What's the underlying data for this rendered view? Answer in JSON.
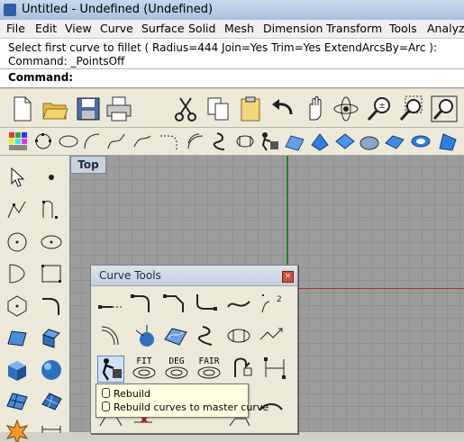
{
  "window": {
    "title": "Untitled - Undefined (Undefined)"
  },
  "menu": [
    "File",
    "Edit",
    "View",
    "Curve",
    "Surface",
    "Solid",
    "Mesh",
    "Dimension",
    "Transform",
    "Tools",
    "Analyze"
  ],
  "command": {
    "history_line": "Select first curve to fillet ( Radius=444  Join=Yes  Trim=Yes  ExtendArcsBy=Arc ):",
    "history_line2": "Command: _PointsOff",
    "prompt_label": "Command:"
  },
  "toolbar_main": [
    "new-icon",
    "open-icon",
    "save-icon",
    "print-icon",
    "cut-icon",
    "copy-icon",
    "paste-icon",
    "undo-icon",
    "pan-icon",
    "rotate-view-icon",
    "zoom-in-out-icon",
    "zoom-window-icon",
    "zoom-extents-icon"
  ],
  "viewport": {
    "label": "Top"
  },
  "curve_tools_panel": {
    "title": "Curve Tools",
    "labels": [
      "FIT",
      "DEG",
      "FAIR"
    ]
  },
  "tooltip": {
    "line1": "Rebuild",
    "line2": "Rebuild curves to master curve"
  },
  "colors": {
    "axis_x": "#b03030",
    "axis_y": "#1b8a1b",
    "viewport_bg": "#9c9c9c",
    "tooltip_bg": "#ffffe1"
  }
}
